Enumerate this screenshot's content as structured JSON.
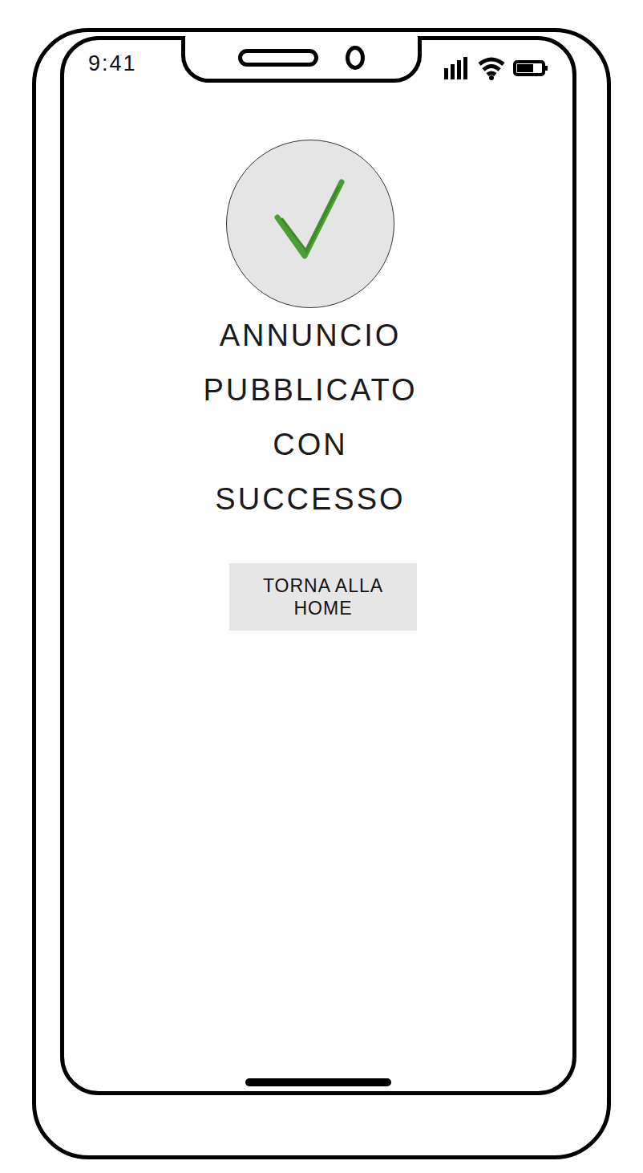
{
  "status_bar": {
    "time": "9:41"
  },
  "message": {
    "lines": [
      "ANNUNCIO",
      "PUBBLICATO",
      "CON",
      "SUCCESSO"
    ]
  },
  "buttons": [
    {
      "label": "TORNA ALLA HOME"
    }
  ]
}
